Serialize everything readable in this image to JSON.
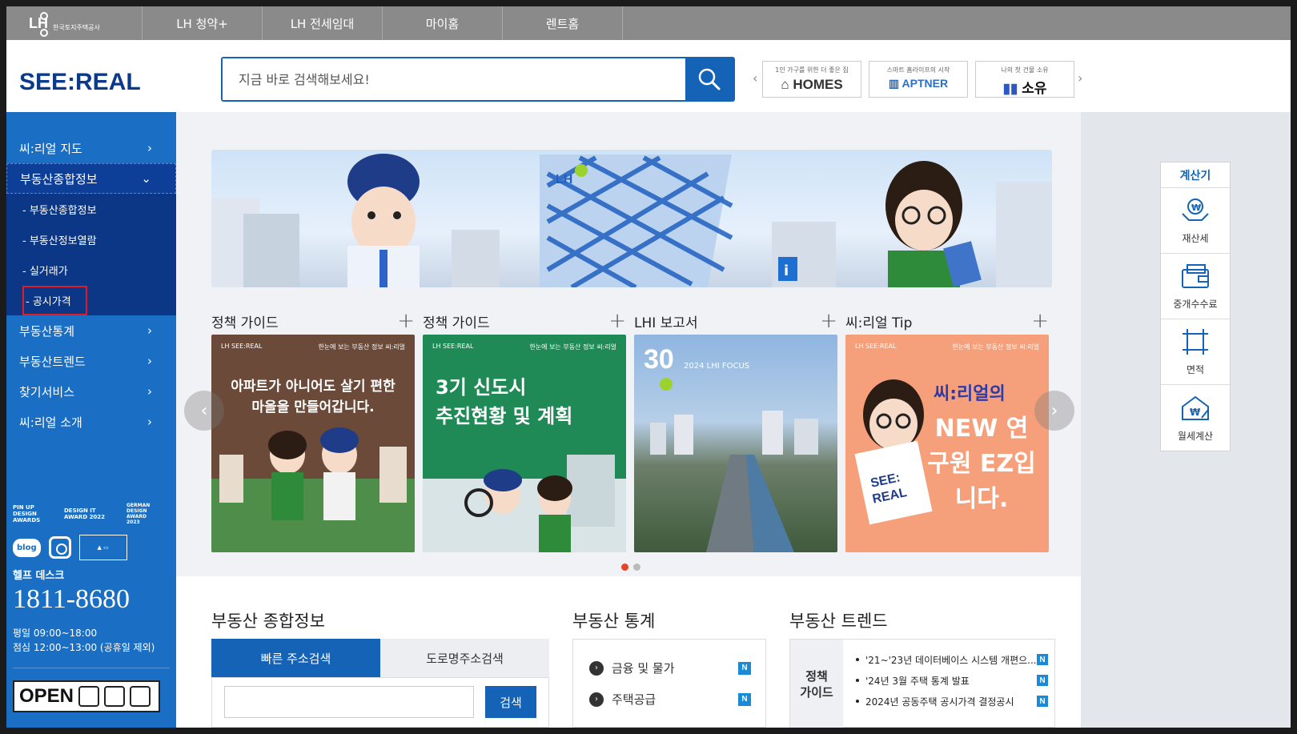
{
  "topbar": {
    "logo_text": "LH",
    "logo_sub": "한국토지주택공사",
    "nav": [
      "LH 청약+",
      "LH 전세임대",
      "마이홈",
      "렌트홈"
    ]
  },
  "header": {
    "brand": "SEE:REAL",
    "search_placeholder": "지금 바로 검색해보세요!",
    "partners": [
      {
        "sub": "1인 가구를 위한 더 좋은 집",
        "name": "HOMES"
      },
      {
        "sub": "스마트 홈라이프의 시작",
        "name": "APTNER"
      },
      {
        "sub": "나의 첫 건물 소유",
        "name": "소유"
      }
    ]
  },
  "sidebar": {
    "items": [
      {
        "label": "씨:리얼 지도"
      },
      {
        "label": "부동산종합정보"
      },
      {
        "label": "부동산통계"
      },
      {
        "label": "부동산트렌드"
      },
      {
        "label": "찾기서비스"
      },
      {
        "label": "씨:리얼 소개"
      }
    ],
    "sub_items": [
      "- 부동산종합정보",
      "- 부동산정보열람",
      "- 실거래가",
      "- 공시가격"
    ],
    "awards": [
      "PIN UP DESIGN AWARDS",
      "DESIGN IT AWARD 2022",
      "GERMAN DESIGN AWARD 2023"
    ],
    "social": {
      "blog": "blog"
    },
    "help_title": "헬프 데스크",
    "help_phone": "1811-8680",
    "help_hours_1": "평일 09:00~18:00",
    "help_hours_2": "점심 12:00~13:00 (공휴일 제외)",
    "open_badge": "OPEN"
  },
  "cards": [
    {
      "heading": "정책 가이드",
      "top_left": "LH SEE:REAL",
      "top_right": "한눈에 보는 부동산 정보 씨:리얼",
      "title_1": "아파트가 아니어도 살기 편한",
      "title_2": "마을을 만들어갑니다."
    },
    {
      "heading": "정책 가이드",
      "top_left": "LH SEE:REAL",
      "top_right": "한눈에 보는 부동산 정보 씨:리얼",
      "title_1": "3기 신도시",
      "title_2": "추진현황 및 계획"
    },
    {
      "heading": "LHI 보고서",
      "top_left": "30",
      "top_right": "2024 LHI FOCUS",
      "title_1": "",
      "title_2": ""
    },
    {
      "heading": "씨:리얼 Tip",
      "top_left": "LH SEE:REAL",
      "top_right": "한눈에 보는 부동산 정보 씨:리얼",
      "title_1": "씨:리얼의",
      "title_2": "NEW 연구원 EZ입니다."
    }
  ],
  "sections": {
    "info_title": "부동산 종합정보",
    "tab_quick": "빠른 주소검색",
    "tab_road": "도로명주소검색",
    "search_btn": "검색",
    "stats_title": "부동산 통계",
    "stats": [
      {
        "label": "금융 및 물가",
        "badge": "N"
      },
      {
        "label": "주택공급",
        "badge": "N"
      }
    ],
    "trend_title": "부동산 트렌드",
    "trend_label_1": "정책",
    "trend_label_2": "가이드",
    "trends": [
      {
        "text": "'21~'23년 데이터베이스 시스템 개편으...",
        "badge": "N"
      },
      {
        "text": "'24년 3월 주택 통계 발표",
        "badge": "N"
      },
      {
        "text": "2024년 공동주택 공시가격 결정공시",
        "badge": "N"
      }
    ]
  },
  "calculator": {
    "title": "계산기",
    "items": [
      "재산세",
      "중개수수료",
      "면적",
      "월세계산"
    ]
  },
  "colors": {
    "primary": "#1563b6",
    "sidebar": "#1a6fc4",
    "sidebar_active": "#0c3787",
    "highlight": "#e31b23"
  }
}
